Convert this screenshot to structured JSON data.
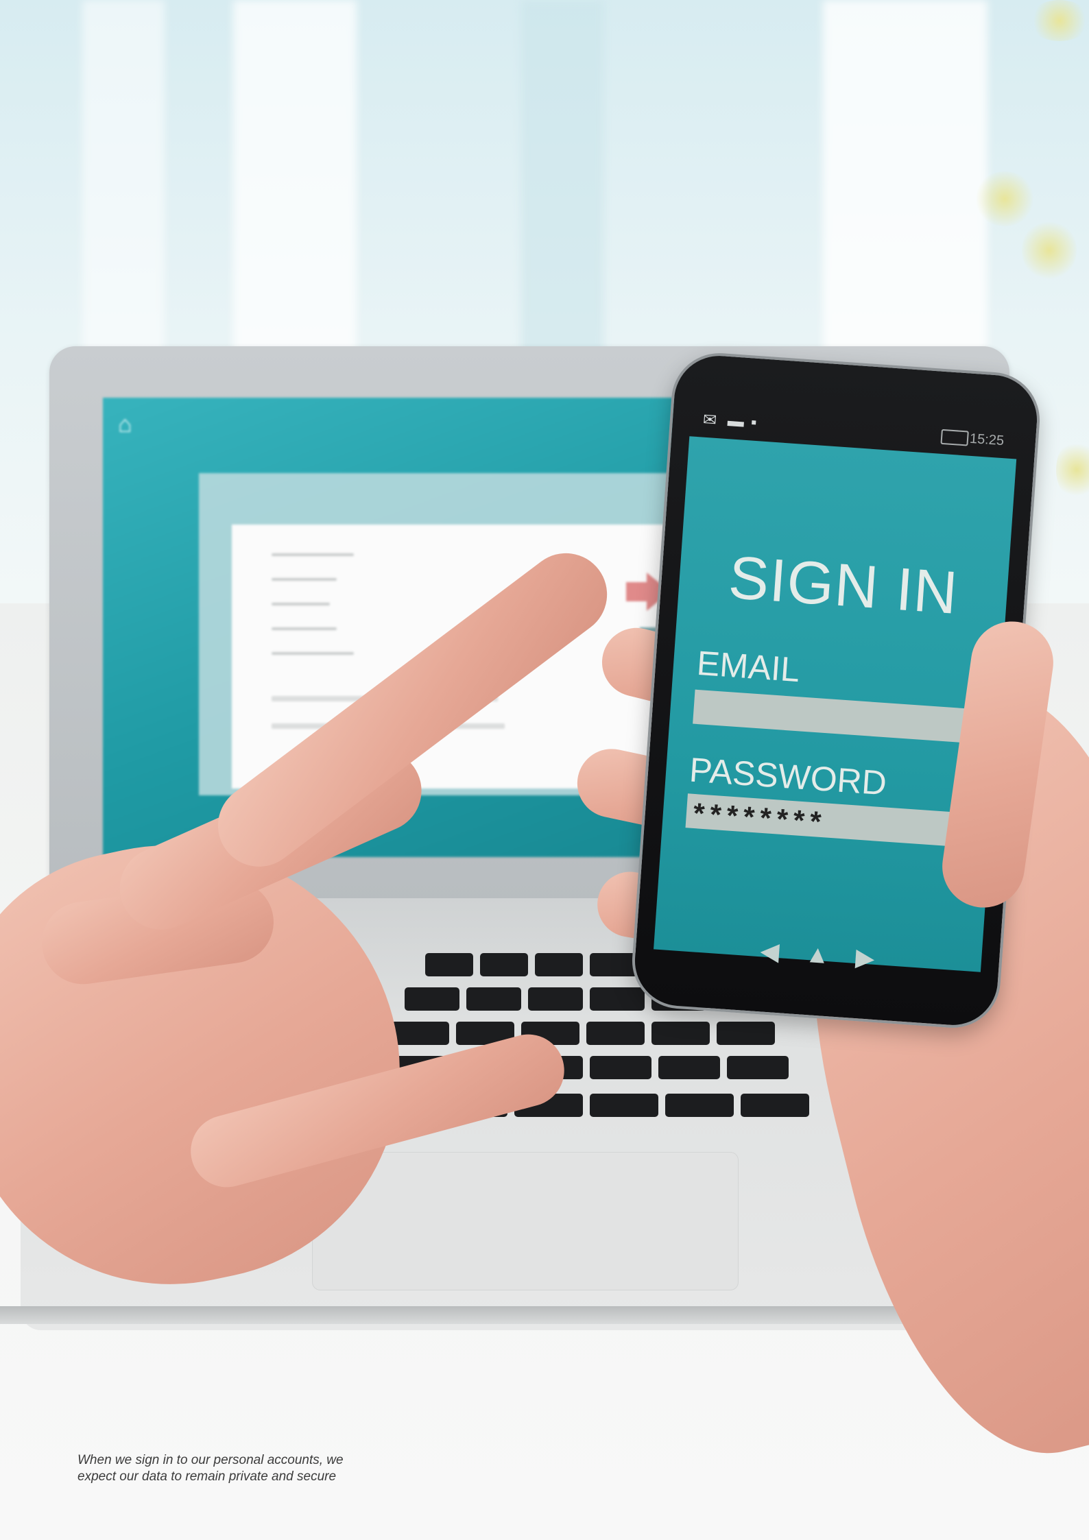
{
  "laptop": {
    "home_icon": "home-icon",
    "cart_icon": "shopping-cart-icon",
    "arrow_icon": "arrow-right-icon"
  },
  "phone": {
    "status_icons": [
      "mail-icon",
      "battery-icon",
      "camera-icon"
    ],
    "time": "15:25",
    "title": "SIGN IN",
    "email_label": "EMAIL",
    "email_value": "",
    "password_label": "PASSWORD",
    "password_value": "********",
    "nav_icons": [
      "back-arrow-icon",
      "home-arrow-icon",
      "forward-arrow-icon"
    ]
  },
  "colors": {
    "screen_teal": "#239aa3",
    "field_grey": "#bdc8c4",
    "accent_red": "#e08a8a"
  },
  "caption": {
    "line1": "When we sign in to our personal accounts, we",
    "line2": "expect our data to remain private and secure"
  }
}
